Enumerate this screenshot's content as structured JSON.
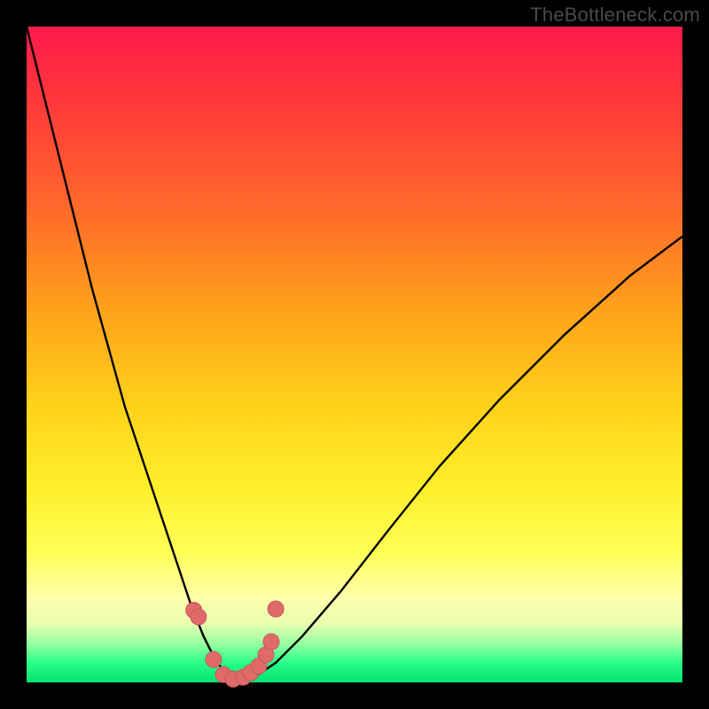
{
  "watermark": "TheBottleneck.com",
  "colors": {
    "frame": "#000000",
    "curve": "#000000",
    "marker_fill": "#e06a6a",
    "marker_stroke": "#c85a5a",
    "gradient_top": "#ff1a4a",
    "gradient_bottom": "#00e070"
  },
  "chart_data": {
    "type": "line",
    "title": "",
    "xlabel": "",
    "ylabel": "",
    "xlim": [
      0,
      100
    ],
    "ylim": [
      0,
      100
    ],
    "series": [
      {
        "name": "bottleneck-curve",
        "x": [
          0,
          5,
          10,
          15,
          20,
          23,
          25,
          27,
          29,
          31,
          33,
          35,
          38,
          42,
          48,
          55,
          63,
          72,
          82,
          92,
          100
        ],
        "values": [
          100,
          80,
          60,
          42,
          27,
          18,
          12,
          7,
          3,
          1,
          0,
          1,
          3,
          7,
          14,
          23,
          33,
          43,
          53,
          62,
          68
        ]
      }
    ],
    "markers": {
      "name": "data-points",
      "x": [
        25.5,
        26.2,
        28.5,
        30.0,
        31.5,
        33.0,
        34.2,
        35.4,
        36.5,
        37.3,
        38.0
      ],
      "values": [
        11.0,
        10.0,
        3.5,
        1.2,
        0.5,
        0.8,
        1.5,
        2.5,
        4.2,
        6.2,
        11.2
      ]
    },
    "grid": false,
    "legend": false
  }
}
